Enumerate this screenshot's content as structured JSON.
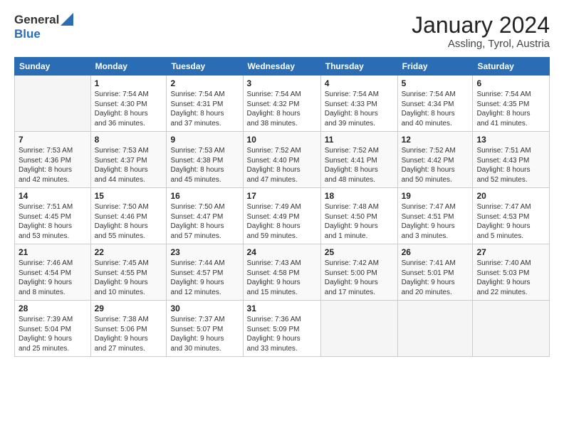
{
  "logo": {
    "line1": "General",
    "line2": "Blue"
  },
  "header": {
    "month": "January 2024",
    "location": "Assling, Tyrol, Austria"
  },
  "weekdays": [
    "Sunday",
    "Monday",
    "Tuesday",
    "Wednesday",
    "Thursday",
    "Friday",
    "Saturday"
  ],
  "weeks": [
    [
      {
        "day": "",
        "info": ""
      },
      {
        "day": "1",
        "info": "Sunrise: 7:54 AM\nSunset: 4:30 PM\nDaylight: 8 hours\nand 36 minutes."
      },
      {
        "day": "2",
        "info": "Sunrise: 7:54 AM\nSunset: 4:31 PM\nDaylight: 8 hours\nand 37 minutes."
      },
      {
        "day": "3",
        "info": "Sunrise: 7:54 AM\nSunset: 4:32 PM\nDaylight: 8 hours\nand 38 minutes."
      },
      {
        "day": "4",
        "info": "Sunrise: 7:54 AM\nSunset: 4:33 PM\nDaylight: 8 hours\nand 39 minutes."
      },
      {
        "day": "5",
        "info": "Sunrise: 7:54 AM\nSunset: 4:34 PM\nDaylight: 8 hours\nand 40 minutes."
      },
      {
        "day": "6",
        "info": "Sunrise: 7:54 AM\nSunset: 4:35 PM\nDaylight: 8 hours\nand 41 minutes."
      }
    ],
    [
      {
        "day": "7",
        "info": "Sunrise: 7:53 AM\nSunset: 4:36 PM\nDaylight: 8 hours\nand 42 minutes."
      },
      {
        "day": "8",
        "info": "Sunrise: 7:53 AM\nSunset: 4:37 PM\nDaylight: 8 hours\nand 44 minutes."
      },
      {
        "day": "9",
        "info": "Sunrise: 7:53 AM\nSunset: 4:38 PM\nDaylight: 8 hours\nand 45 minutes."
      },
      {
        "day": "10",
        "info": "Sunrise: 7:52 AM\nSunset: 4:40 PM\nDaylight: 8 hours\nand 47 minutes."
      },
      {
        "day": "11",
        "info": "Sunrise: 7:52 AM\nSunset: 4:41 PM\nDaylight: 8 hours\nand 48 minutes."
      },
      {
        "day": "12",
        "info": "Sunrise: 7:52 AM\nSunset: 4:42 PM\nDaylight: 8 hours\nand 50 minutes."
      },
      {
        "day": "13",
        "info": "Sunrise: 7:51 AM\nSunset: 4:43 PM\nDaylight: 8 hours\nand 52 minutes."
      }
    ],
    [
      {
        "day": "14",
        "info": "Sunrise: 7:51 AM\nSunset: 4:45 PM\nDaylight: 8 hours\nand 53 minutes."
      },
      {
        "day": "15",
        "info": "Sunrise: 7:50 AM\nSunset: 4:46 PM\nDaylight: 8 hours\nand 55 minutes."
      },
      {
        "day": "16",
        "info": "Sunrise: 7:50 AM\nSunset: 4:47 PM\nDaylight: 8 hours\nand 57 minutes."
      },
      {
        "day": "17",
        "info": "Sunrise: 7:49 AM\nSunset: 4:49 PM\nDaylight: 8 hours\nand 59 minutes."
      },
      {
        "day": "18",
        "info": "Sunrise: 7:48 AM\nSunset: 4:50 PM\nDaylight: 9 hours\nand 1 minute."
      },
      {
        "day": "19",
        "info": "Sunrise: 7:47 AM\nSunset: 4:51 PM\nDaylight: 9 hours\nand 3 minutes."
      },
      {
        "day": "20",
        "info": "Sunrise: 7:47 AM\nSunset: 4:53 PM\nDaylight: 9 hours\nand 5 minutes."
      }
    ],
    [
      {
        "day": "21",
        "info": "Sunrise: 7:46 AM\nSunset: 4:54 PM\nDaylight: 9 hours\nand 8 minutes."
      },
      {
        "day": "22",
        "info": "Sunrise: 7:45 AM\nSunset: 4:55 PM\nDaylight: 9 hours\nand 10 minutes."
      },
      {
        "day": "23",
        "info": "Sunrise: 7:44 AM\nSunset: 4:57 PM\nDaylight: 9 hours\nand 12 minutes."
      },
      {
        "day": "24",
        "info": "Sunrise: 7:43 AM\nSunset: 4:58 PM\nDaylight: 9 hours\nand 15 minutes."
      },
      {
        "day": "25",
        "info": "Sunrise: 7:42 AM\nSunset: 5:00 PM\nDaylight: 9 hours\nand 17 minutes."
      },
      {
        "day": "26",
        "info": "Sunrise: 7:41 AM\nSunset: 5:01 PM\nDaylight: 9 hours\nand 20 minutes."
      },
      {
        "day": "27",
        "info": "Sunrise: 7:40 AM\nSunset: 5:03 PM\nDaylight: 9 hours\nand 22 minutes."
      }
    ],
    [
      {
        "day": "28",
        "info": "Sunrise: 7:39 AM\nSunset: 5:04 PM\nDaylight: 9 hours\nand 25 minutes."
      },
      {
        "day": "29",
        "info": "Sunrise: 7:38 AM\nSunset: 5:06 PM\nDaylight: 9 hours\nand 27 minutes."
      },
      {
        "day": "30",
        "info": "Sunrise: 7:37 AM\nSunset: 5:07 PM\nDaylight: 9 hours\nand 30 minutes."
      },
      {
        "day": "31",
        "info": "Sunrise: 7:36 AM\nSunset: 5:09 PM\nDaylight: 9 hours\nand 33 minutes."
      },
      {
        "day": "",
        "info": ""
      },
      {
        "day": "",
        "info": ""
      },
      {
        "day": "",
        "info": ""
      }
    ]
  ]
}
